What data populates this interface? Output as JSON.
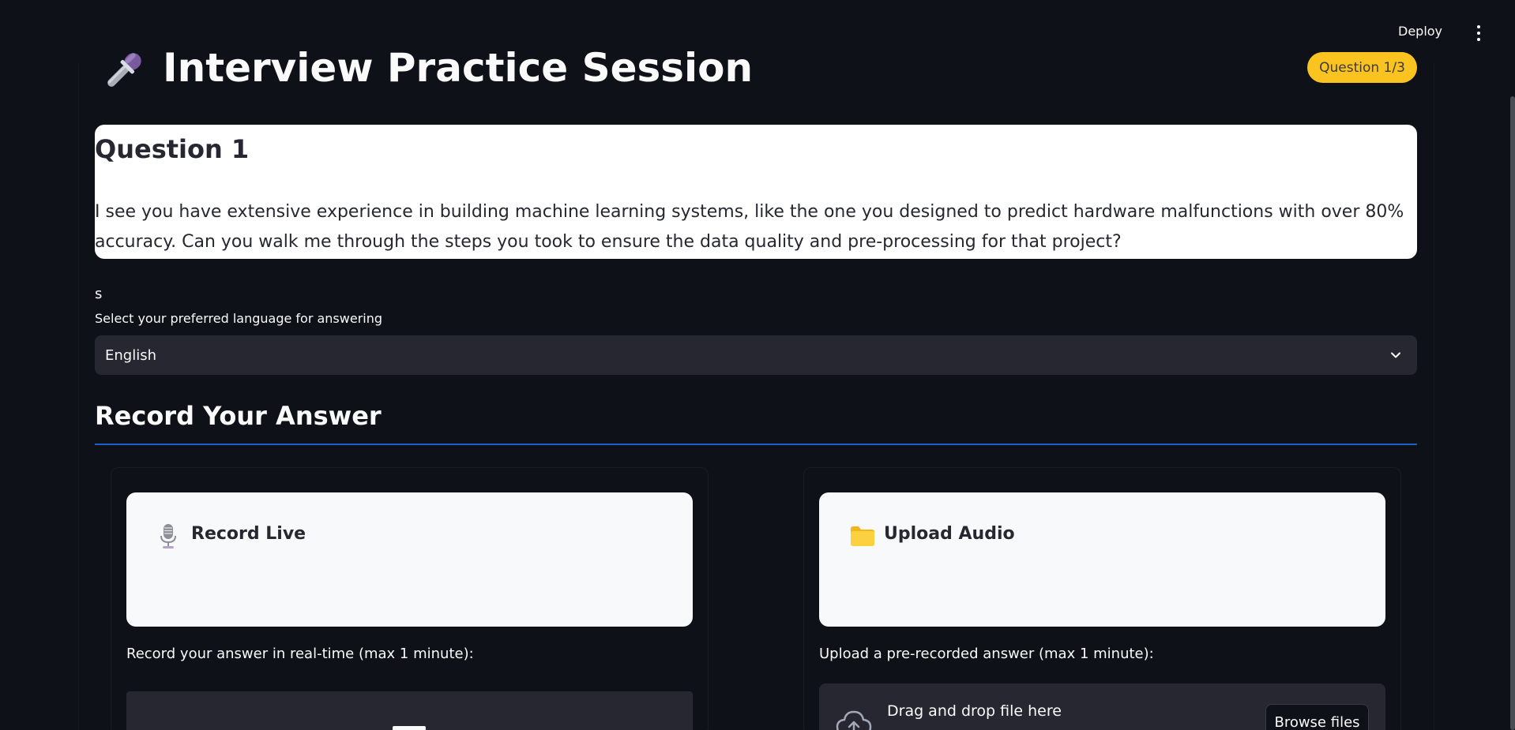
{
  "header": {
    "deploy_label": "Deploy",
    "menu_icon": "more-vertical-icon"
  },
  "title": {
    "icon": "microphone-icon",
    "text": "Interview Practice Session"
  },
  "badge": {
    "text": "Question 1/3",
    "color": "#fbc31f"
  },
  "question": {
    "heading": "Question 1",
    "text": "I see you have extensive experience in building machine learning systems, like the one you designed to predict hardware malfunctions with over 80% accuracy. Can you walk me through the steps you took to ensure the data quality and pre-processing for that project?"
  },
  "stray_text": "s",
  "language": {
    "label": "Select your preferred language for answering",
    "selected": "English"
  },
  "record_section": {
    "heading": "Record Your Answer",
    "divider_color": "#1c5ec7"
  },
  "record_live": {
    "icon": "studio-microphone-icon",
    "title": "Record Live",
    "instruction": "Record your answer in real-time (max 1 minute):"
  },
  "upload_audio": {
    "icon": "folder-icon",
    "title": "Upload Audio",
    "instruction": "Upload a pre-recorded answer (max 1 minute):",
    "dropzone_text": "Drag and drop file here",
    "browse_label": "Browse files"
  },
  "colors": {
    "background": "#0e1117",
    "card": "#f8f9fb",
    "select_bg": "#262730"
  }
}
